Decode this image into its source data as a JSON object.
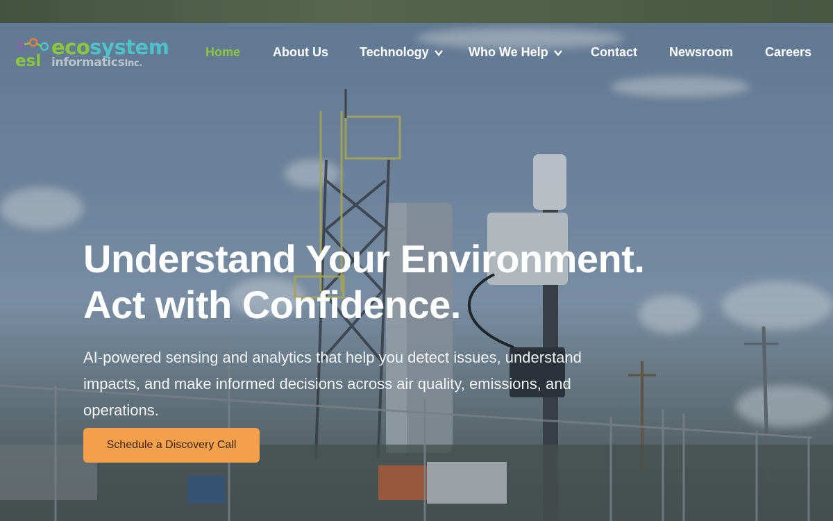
{
  "logo": {
    "line1_a": "eco",
    "line1_b": "system",
    "line2": "informatics",
    "suffix": "Inc.",
    "monogram": "esl",
    "icon": "molecule-icon",
    "colors": {
      "green": "#8cc63f",
      "teal": "#4fc1c9",
      "gray": "#b9c4cc",
      "orange": "#f07b3f",
      "purple": "#8e5fa8"
    }
  },
  "nav": {
    "items": [
      {
        "label": "Home",
        "active": true
      },
      {
        "label": "About Us"
      },
      {
        "label": "Technology",
        "dropdown": true,
        "icon": "chevron-down-icon"
      },
      {
        "label": "Who We Help",
        "dropdown": true,
        "icon": "chevron-down-icon"
      },
      {
        "label": "Contact"
      },
      {
        "label": "Newsroom"
      },
      {
        "label": "Careers"
      }
    ]
  },
  "hero": {
    "headline_line1": "Understand Your Environment.",
    "headline_line2": "Act with Confidence.",
    "subtext": "AI-powered sensing and analytics that help you detect issues, understand impacts, and make informed decisions across air quality, emissions, and operations.",
    "cta_label": "Schedule a Discovery Call"
  },
  "colors": {
    "accent_green": "#8cc63f",
    "cta_orange": "#f5a04a",
    "text_white": "#ffffff"
  }
}
